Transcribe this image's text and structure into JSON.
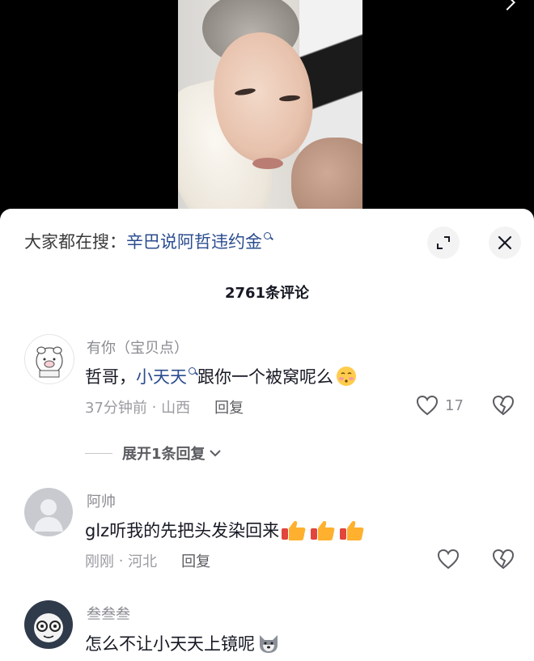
{
  "search": {
    "prefix": "大家都在搜：",
    "term": "辛巴说阿哲违约金"
  },
  "header": {
    "comment_count": "2761条评论"
  },
  "comments": [
    {
      "username": "有你（宝贝点）",
      "text_before": "哲哥，",
      "mention": "小天天",
      "text_after": "跟你一个被窝呢么",
      "emoji": "blushing-emoji",
      "time": "37分钟前",
      "location": "山西",
      "reply_label": "回复",
      "likes": "17",
      "expand_label": "展开1条回复"
    },
    {
      "username": "阿帅",
      "text": "glz听我的先把头发染回来",
      "emoji": "thumbs-up-emoji x3",
      "time": "刚刚",
      "location": "河北",
      "reply_label": "回复",
      "likes": ""
    },
    {
      "username": "叁叁叁",
      "text": "怎么不让小天天上镜呢",
      "emoji": "dog-face-emoji"
    }
  ],
  "colors": {
    "link": "#2b4d8f",
    "muted": "#8a8b91",
    "text": "#161823"
  }
}
